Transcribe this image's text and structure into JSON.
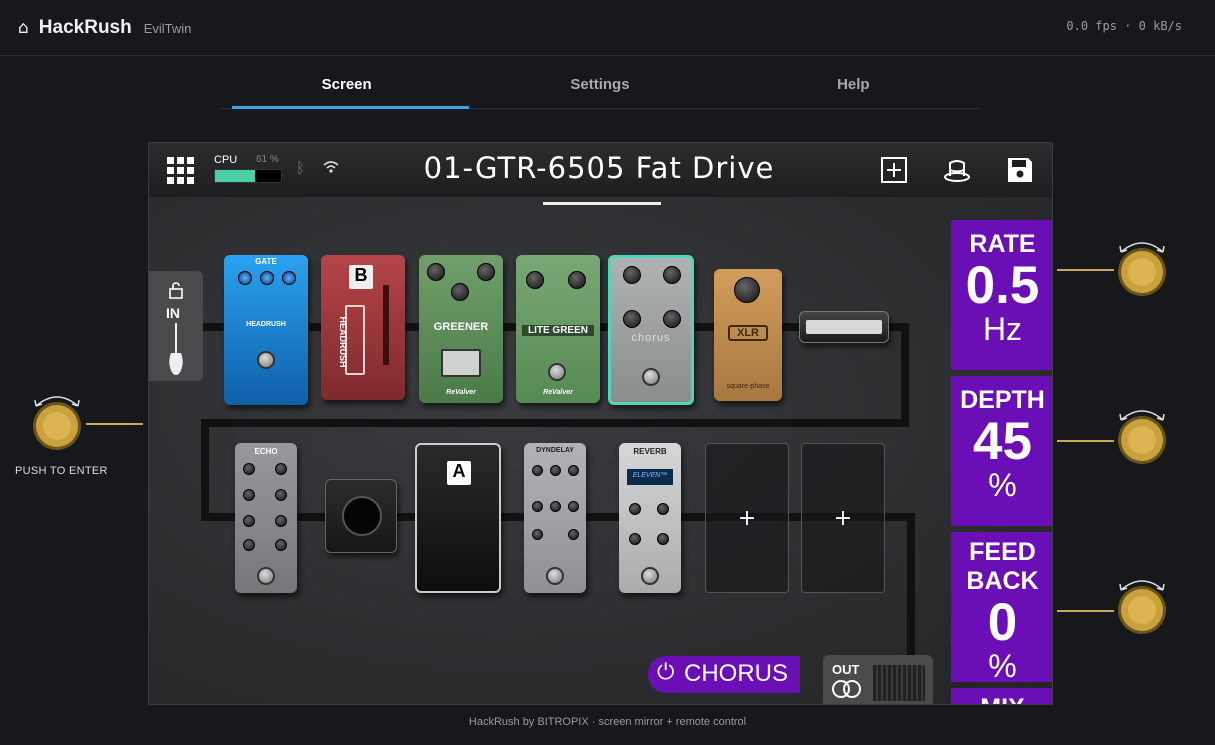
{
  "app": {
    "home_icon": "⌂",
    "name": "HackRush",
    "device": "EvilTwin",
    "stats": "0.0 fps · 0 kB/s"
  },
  "tabs": [
    {
      "label": "Screen",
      "active": true
    },
    {
      "label": "Settings",
      "active": false
    },
    {
      "label": "Help",
      "active": false
    }
  ],
  "device_screen": {
    "cpu_label": "CPU",
    "cpu_percent_text": "61 %",
    "cpu_level": 0.61,
    "preset_name": "01-GTR-6505 Fat Drive",
    "input_label": "IN",
    "chain_row1": [
      {
        "name": "GATE",
        "sub": "HEADRUSH",
        "color": "#1e8fe0"
      },
      {
        "name": "B",
        "sub": "HEADRUSH",
        "color": "#a8393c"
      },
      {
        "name": "GREENER",
        "sub": "ReValver",
        "color": "#5f8f5c"
      },
      {
        "name": "LITE GREEN",
        "sub": "ReValver",
        "color": "#6a9a67"
      },
      {
        "name": "chorus",
        "color": "#9fa3a3",
        "selected": true
      },
      {
        "name": "XLR",
        "sub": "square-phase",
        "color": "#c99552"
      }
    ],
    "chain_row2": [
      {
        "name": "ECHO",
        "color": "#8b8d90"
      },
      {
        "name": "A",
        "color": "#1a1a1a"
      },
      {
        "name": "DYNDELAY",
        "color": "#a9aaad"
      },
      {
        "name": "REVERB",
        "display": "ELEVEN™",
        "color": "#c8c9cb"
      }
    ],
    "empty_slot_symbol": "+",
    "params": [
      {
        "name": "RATE",
        "value": "0.5",
        "unit": "Hz"
      },
      {
        "name": "DEPTH",
        "value": "45",
        "unit": "%"
      },
      {
        "name_line1": "FEED",
        "name_line2": "BACK",
        "value": "0",
        "unit": "%"
      },
      {
        "name": "MIX"
      }
    ],
    "active_block": "CHORUS",
    "output_label": "OUT",
    "accent": "#6a0fb5"
  },
  "left_knob_label": "PUSH TO ENTER",
  "footer": "HackRush by BITROPIX · screen mirror + remote control"
}
